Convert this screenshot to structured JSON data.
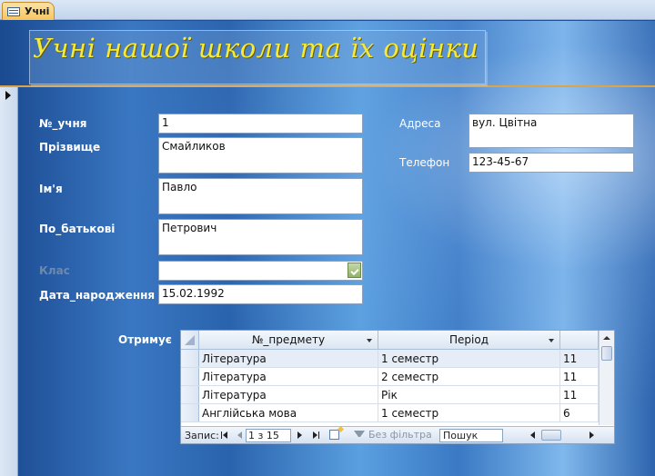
{
  "tab": {
    "label": "Учні",
    "icon": "form-icon"
  },
  "form": {
    "title": "Учні нашої школи та їх оцінки",
    "fields": {
      "student_no": {
        "label": "№_учня",
        "value": "1"
      },
      "surname": {
        "label": "Прізвище",
        "value": "Смайликов"
      },
      "name": {
        "label": "Ім'я",
        "value": "Павло"
      },
      "patronymic": {
        "label": "По_батькові",
        "value": "Петрович"
      },
      "class": {
        "label": "Клас",
        "value": ""
      },
      "birthdate": {
        "label": "Дата_народження",
        "value": "15.02.1992"
      },
      "address": {
        "label": "Адреса",
        "value": "вул. Цвітна"
      },
      "phone": {
        "label": "Телефон",
        "value": "123-45-67"
      }
    },
    "subform_label": "Отримує"
  },
  "subform": {
    "columns": [
      "№_предмету",
      "Період",
      ""
    ],
    "rows": [
      [
        "Література",
        "1 семестр",
        "11"
      ],
      [
        "Література",
        "2 семестр",
        "11"
      ],
      [
        "Література",
        "Рік",
        "11"
      ],
      [
        "Англійська мова",
        "1 семестр",
        "6"
      ]
    ],
    "navigation": {
      "record_label": "Запис:",
      "counter": "1 з 15",
      "filter_label": "Без фільтра",
      "search_placeholder": "Пошук"
    }
  },
  "colors": {
    "title": "#f4ea3a",
    "tab_active": "#f7c560",
    "background": "#2a63ad"
  }
}
